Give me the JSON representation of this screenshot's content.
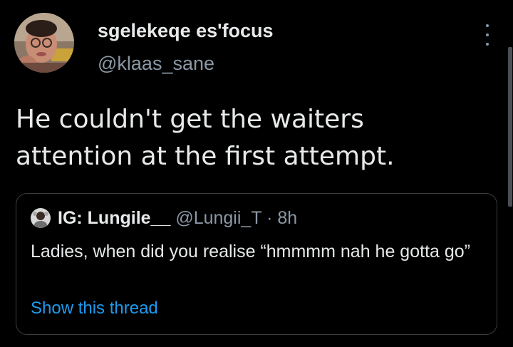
{
  "author": {
    "display_name": "sgelekeqe es'focus",
    "handle": "@klaas_sane",
    "avatar_icon": "profile-photo"
  },
  "tweet": {
    "text": "He couldn't get the waiters attention at the first attempt."
  },
  "quoted_tweet": {
    "display_name": "IG: Lungile__",
    "handle": "@Lungii_T",
    "separator": " · ",
    "time": "8h",
    "text": "Ladies, when did you realise “hmmmm nah he gotta go”",
    "show_thread_label": "Show this thread",
    "avatar_icon": "profile-photo"
  },
  "colors": {
    "background": "#000000",
    "primary_text": "#e7e9ea",
    "secondary_text": "#8b98a5",
    "link": "#1d9bf0",
    "border": "#3a3e42"
  }
}
